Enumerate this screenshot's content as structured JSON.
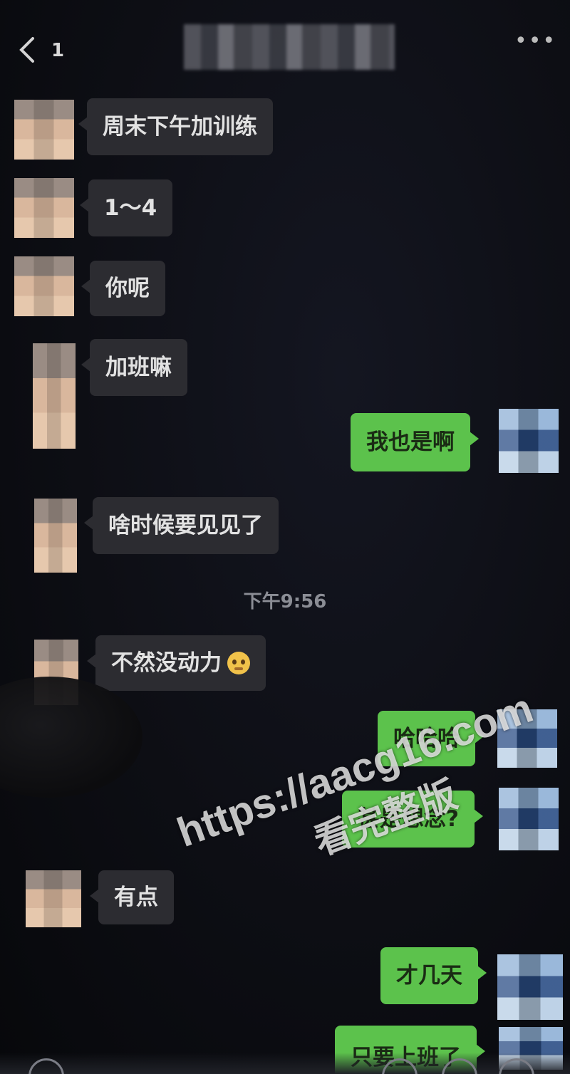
{
  "header": {
    "back_icon": "chevron-left-icon",
    "unread_count": "1",
    "more_icon": "ellipsis-icon"
  },
  "messages": [
    {
      "side": "in",
      "text": "周末下午加训练"
    },
    {
      "side": "in",
      "text": "1～4"
    },
    {
      "side": "in",
      "text": "你呢"
    },
    {
      "side": "in",
      "text": "加班嘛"
    },
    {
      "side": "out",
      "text": "我也是啊"
    },
    {
      "side": "in",
      "text": "啥时候要见见了"
    },
    {
      "side": "in",
      "text": "不然没动力",
      "emoji": "pleading-face-icon"
    },
    {
      "side": "out",
      "text": "哈哈哈"
    },
    {
      "side": "out",
      "text": "甚是想念?"
    },
    {
      "side": "in",
      "text": "有点"
    },
    {
      "side": "out",
      "text": "才几天"
    },
    {
      "side": "out",
      "text": "只要上班了"
    }
  ],
  "timestamp": "下午9:56",
  "watermark": {
    "url": "https://aacg16.com",
    "caption": "看完整版"
  },
  "colors": {
    "background": "#0d0e14",
    "incoming_bubble": "#2c2c31",
    "outgoing_bubble": "#5cc24c"
  }
}
